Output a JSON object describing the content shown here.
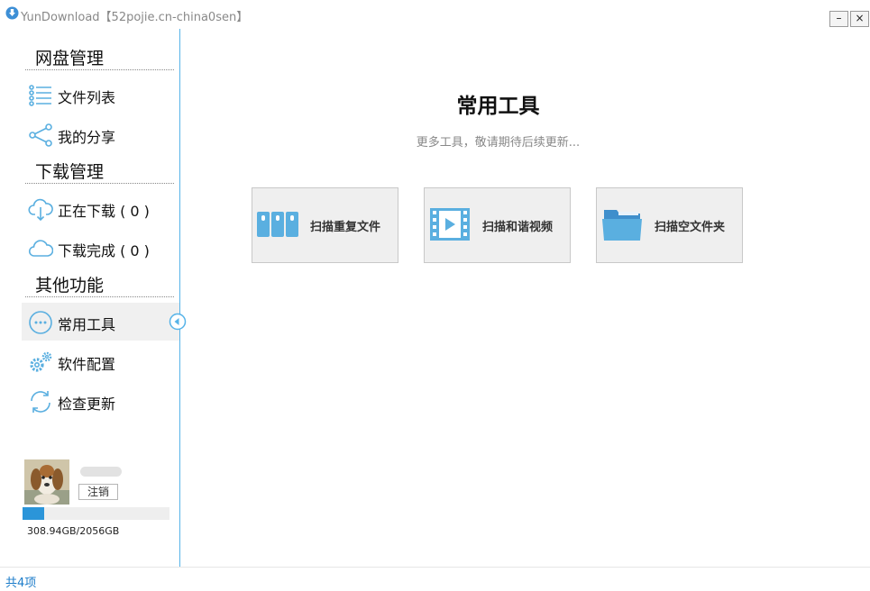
{
  "window": {
    "title": "YunDownload【52pojie.cn-china0sen】",
    "minimize_label": "–",
    "close_label": "×"
  },
  "sidebar": {
    "sections": [
      {
        "title": "网盘管理"
      },
      {
        "title": "下载管理"
      },
      {
        "title": "其他功能"
      }
    ],
    "items": [
      {
        "label": "文件列表",
        "icon": "list-icon"
      },
      {
        "label": "我的分享",
        "icon": "share-icon"
      },
      {
        "label": "正在下载 ( 0 )",
        "icon": "cloud-download-icon"
      },
      {
        "label": "下载完成 ( 0 )",
        "icon": "cloud-icon"
      },
      {
        "label": "常用工具",
        "icon": "more-icon",
        "active": true
      },
      {
        "label": "软件配置",
        "icon": "gear-icon"
      },
      {
        "label": "检查更新",
        "icon": "refresh-icon"
      }
    ]
  },
  "user": {
    "logout_label": "注销",
    "storage_text": "308.94GB/2056GB",
    "storage_used_fraction": 0.15
  },
  "main": {
    "title": "常用工具",
    "subtitle": "更多工具，敬请期待后续更新...",
    "tools": [
      {
        "label": "扫描重复文件",
        "icon": "duplicate-files-icon"
      },
      {
        "label": "扫描和谐视频",
        "icon": "video-icon"
      },
      {
        "label": "扫描空文件夹",
        "icon": "folder-icon"
      }
    ]
  },
  "status": {
    "text": "共4项"
  },
  "colors": {
    "accent": "#56b3e8",
    "icon_blue": "#5aafe0",
    "status_text": "#1a7bc9"
  }
}
